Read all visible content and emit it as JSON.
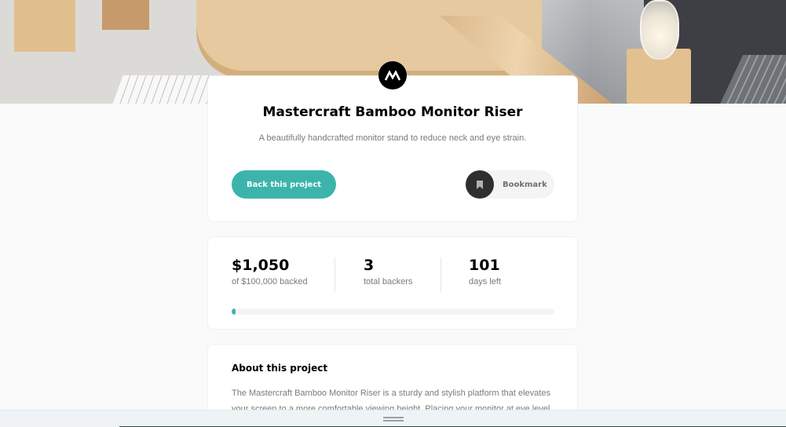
{
  "project": {
    "title": "Mastercraft Bamboo Monitor Riser",
    "subtitle": "A beautifully handcrafted monitor stand to reduce neck and eye strain.",
    "logo_icon": "mastercraft-logo-icon"
  },
  "actions": {
    "back_label": "Back this project",
    "bookmark_label": "Bookmark",
    "bookmark_icon": "bookmark-icon"
  },
  "stats": {
    "backed_value": "$1,050",
    "backed_label": "of $100,000 backed",
    "backers_value": "3",
    "backers_label": "total backers",
    "days_value": "101",
    "days_label": "days left",
    "progress_fraction": 0.0105
  },
  "about": {
    "title": "About this project",
    "text": "The Mastercraft Bamboo Monitor Riser is a sturdy and stylish platform that elevates your screen to a more comfortable viewing height. Placing your monitor at eye level has"
  },
  "colors": {
    "accent": "#3cb4ac",
    "dark": "#2f2f2f",
    "background": "#fafafa"
  }
}
